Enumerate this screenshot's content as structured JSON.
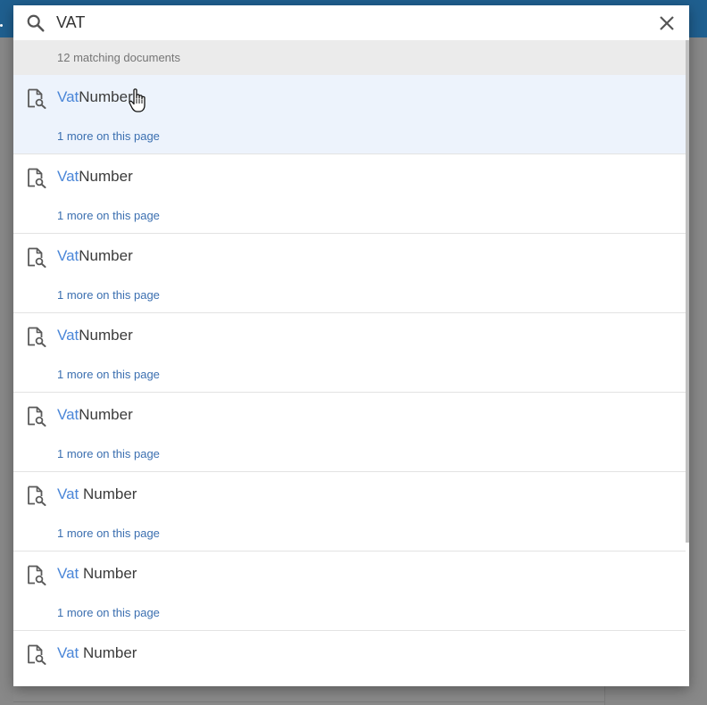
{
  "search": {
    "query": "VAT",
    "result_count_text": "12 matching documents",
    "clear_icon": "close-icon",
    "search_icon": "search-icon"
  },
  "results": [
    {
      "highlight": "Vat",
      "rest": "Number",
      "more": "1 more on this page",
      "icon": "document-search-icon"
    },
    {
      "highlight": "Vat",
      "rest": "Number",
      "more": "1 more on this page",
      "icon": "document-search-icon"
    },
    {
      "highlight": "Vat",
      "rest": "Number",
      "more": "1 more on this page",
      "icon": "document-search-icon"
    },
    {
      "highlight": "Vat",
      "rest": "Number",
      "more": "1 more on this page",
      "icon": "document-search-icon"
    },
    {
      "highlight": "Vat",
      "rest": "Number",
      "more": "1 more on this page",
      "icon": "document-search-icon"
    },
    {
      "highlight": "Vat",
      "rest": " Number",
      "more": "1 more on this page",
      "icon": "document-search-icon"
    },
    {
      "highlight": "Vat",
      "rest": " Number",
      "more": "1 more on this page",
      "icon": "document-search-icon"
    },
    {
      "highlight": "Vat",
      "rest": " Number",
      "more": "",
      "icon": "document-search-icon"
    }
  ],
  "colors": {
    "highlight": "#4a86d8",
    "link": "#3b6fb0",
    "hover_row": "#edf3fc",
    "header_bar": "#1f5f8f"
  }
}
